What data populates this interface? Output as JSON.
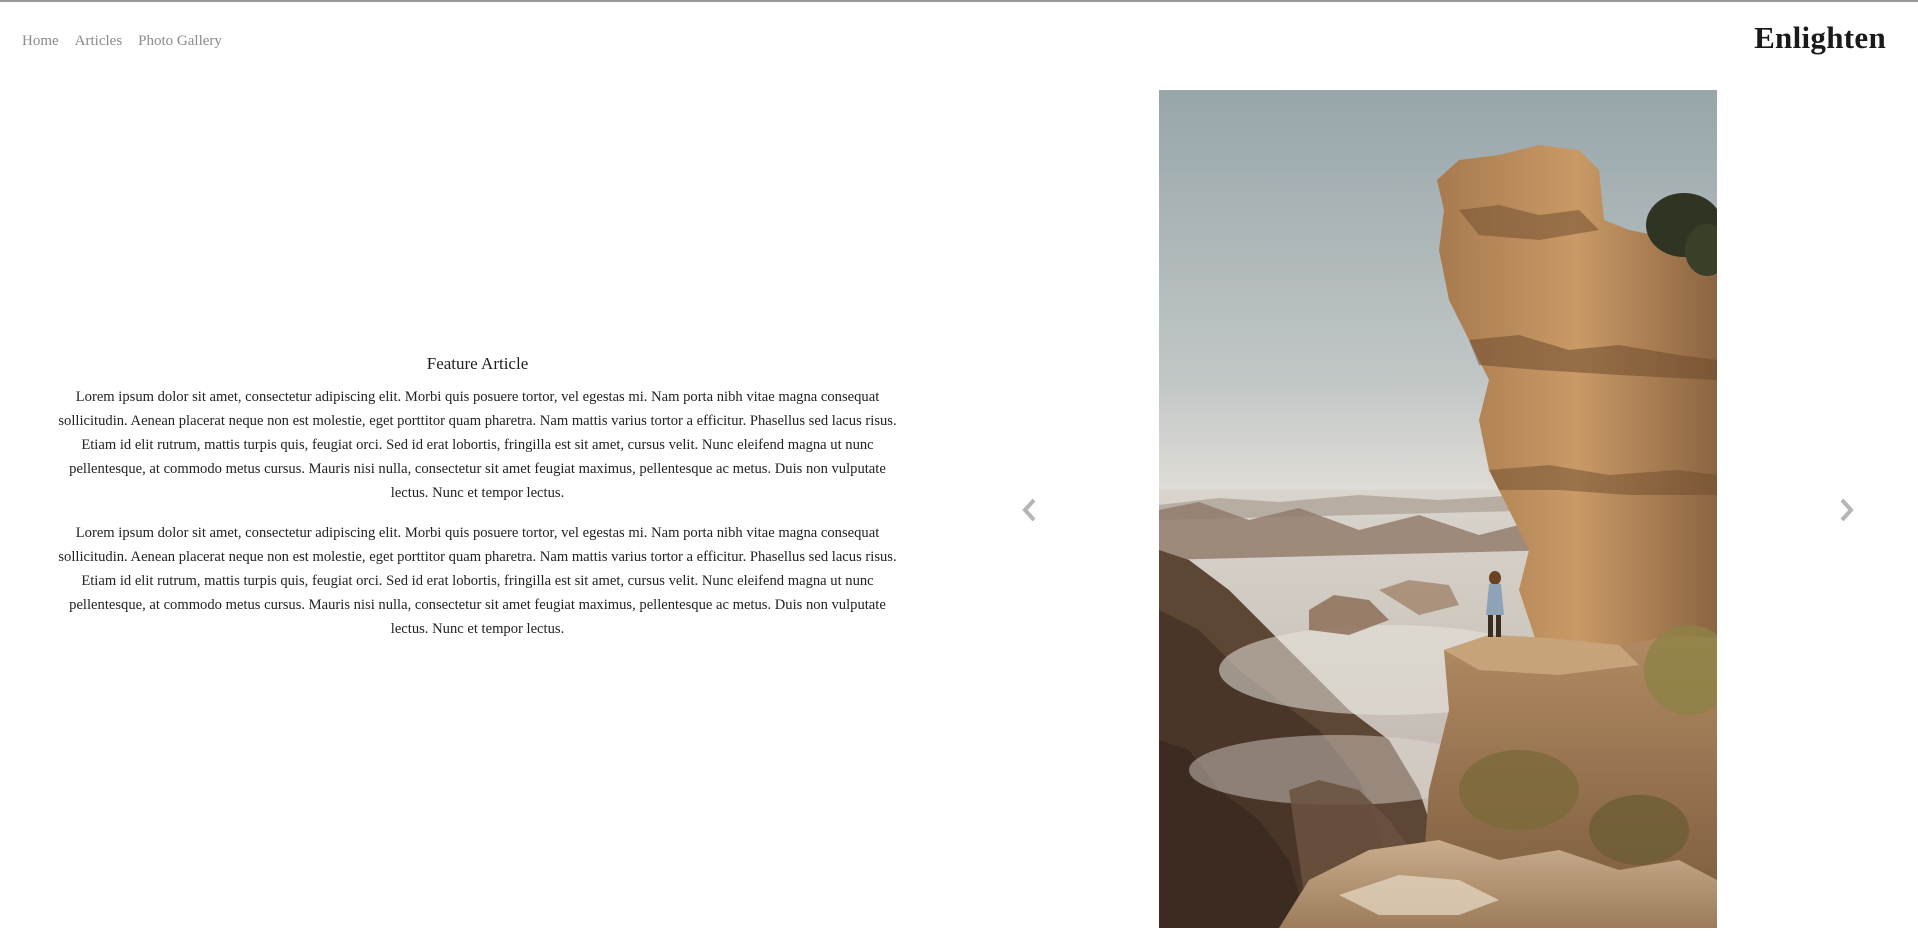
{
  "nav": {
    "items": [
      "Home",
      "Articles",
      "Photo Gallery"
    ]
  },
  "brand": "Enlighten",
  "article": {
    "title": "Feature Article",
    "paragraphs": [
      "Lorem ipsum dolor sit amet, consectetur adipiscing elit. Morbi quis posuere tortor, vel egestas mi. Nam porta nibh vitae magna consequat sollicitudin. Aenean placerat neque non est molestie, eget porttitor quam pharetra. Nam mattis varius tortor a efficitur. Phasellus sed lacus risus. Etiam id elit rutrum, mattis turpis quis, feugiat orci. Sed id erat lobortis, fringilla est sit amet, cursus velit. Nunc eleifend magna ut nunc pellentesque, at commodo metus cursus. Mauris nisi nulla, consectetur sit amet feugiat maximus, pellentesque ac metus. Duis non vulputate lectus. Nunc et tempor lectus.",
      "Lorem ipsum dolor sit amet, consectetur adipiscing elit. Morbi quis posuere tortor, vel egestas mi. Nam porta nibh vitae magna consequat sollicitudin. Aenean placerat neque non est molestie, eget porttitor quam pharetra. Nam mattis varius tortor a efficitur. Phasellus sed lacus risus. Etiam id elit rutrum, mattis turpis quis, feugiat orci. Sed id erat lobortis, fringilla est sit amet, cursus velit. Nunc eleifend magna ut nunc pellentesque, at commodo metus cursus. Mauris nisi nulla, consectetur sit amet feugiat maximus, pellentesque ac metus. Duis non vulputate lectus. Nunc et tempor lectus."
    ]
  },
  "carousel": {
    "prev_icon": "chevron-left-icon",
    "next_icon": "chevron-right-icon",
    "arrow_color": "#b5b5b5"
  },
  "colors": {
    "nav_text": "#8a8a8a",
    "brand_text": "#1a1a1a",
    "body_text": "#222222",
    "top_rule": "#9a9a9a"
  }
}
